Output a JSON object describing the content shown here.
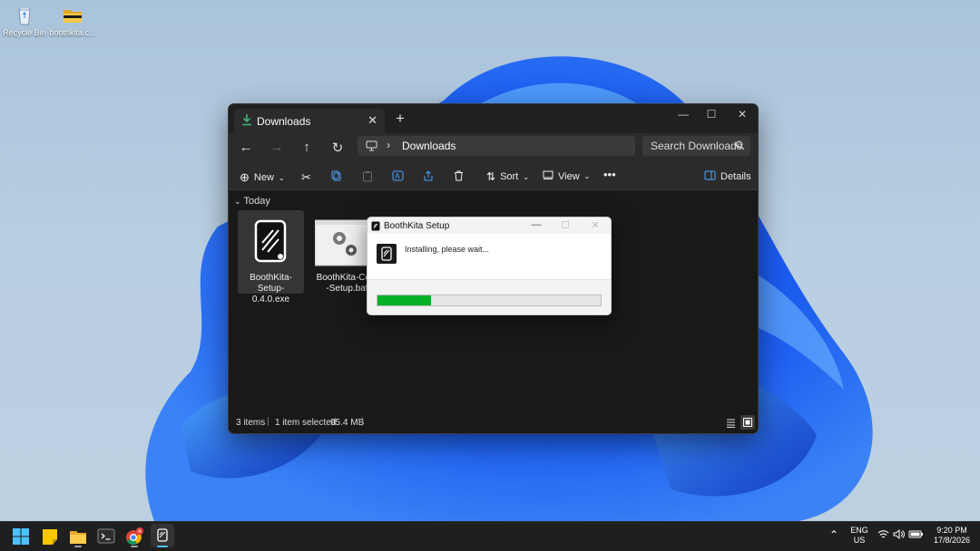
{
  "desktop": {
    "icons": [
      {
        "label": "Recycle Bin",
        "icon": "recycle-bin-icon"
      },
      {
        "label": "boothkita.c...",
        "icon": "folder-icon"
      }
    ]
  },
  "explorer": {
    "tab_title": "Downloads",
    "tab_icon": "download-icon",
    "address": {
      "segment": "Downloads"
    },
    "search_placeholder": "Search Downloads",
    "commands": {
      "new": "New",
      "sort": "Sort",
      "view": "View",
      "details": "Details"
    },
    "group_header": "Today",
    "files": [
      {
        "name": "BoothKita-Setup-0.4.0.exe",
        "line1": "BoothKita-Setup-",
        "line2": "0.4.0.exe",
        "selected": true
      },
      {
        "name": "BoothKita-Cont...-Setup.bat",
        "line1": "BoothKita-Cont",
        "line2": "-Setup.bat",
        "selected": false
      }
    ],
    "status": {
      "items": "3 items",
      "selected": "1 item selected",
      "size": "95.4 MB"
    }
  },
  "setup_dialog": {
    "title": "BoothKita Setup",
    "status_text": "Installing, please wait...",
    "progress": 0.24
  },
  "taskbar": {
    "apps": [
      "start-icon",
      "sticky-notes-icon",
      "file-explorer-icon",
      "terminal-icon",
      "chrome-icon",
      "boothkita-icon"
    ],
    "language_top": "ENG",
    "language_bottom": "US",
    "time": "9:20 PM",
    "date": "17/8/2026"
  },
  "colors": {
    "accent": "#0078d4",
    "progress_green": "#06b025",
    "window_bg": "#191919"
  }
}
